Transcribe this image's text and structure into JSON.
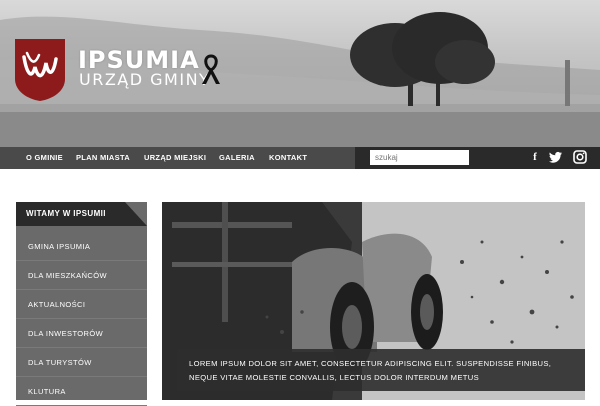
{
  "brand": {
    "name": "IPSUMIA",
    "subtitle": "URZĄD GMINY"
  },
  "nav": {
    "items": [
      "O GMINIE",
      "PLAN MIASTA",
      "URZĄD MIEJSKI",
      "GALERIA",
      "KONTAKT"
    ],
    "search_placeholder": "szukaj"
  },
  "social": {
    "icons": [
      "facebook-icon",
      "twitter-icon",
      "instagram-icon"
    ],
    "facebook_glyph": "f"
  },
  "sidebar": {
    "title": "WITAMY W IPSUMII",
    "items": [
      "GMINA IPSUMIA",
      "DLA MIESZKAŃCÓW",
      "AKTUALNOŚCI",
      "DLA INWESTORÓW",
      "DLA TURYSTÓW",
      "KLUTURA"
    ]
  },
  "slider": {
    "caption_line1": "LOREM IPSUM DOLOR SIT AMET, CONSECTETUR ADIPISCING ELIT. SUSPENDISSE FINIBUS,",
    "caption_line2": "NEQUE VITAE MOLESTIE CONVALLIS, LECTUS DOLOR INTERDUM METUS"
  },
  "colors": {
    "nav_dark": "#2a2a2a",
    "nav_light": "#4a4a4a",
    "sidebar_bg": "#6a6a6a",
    "logo_red": "#8e1b1b"
  }
}
